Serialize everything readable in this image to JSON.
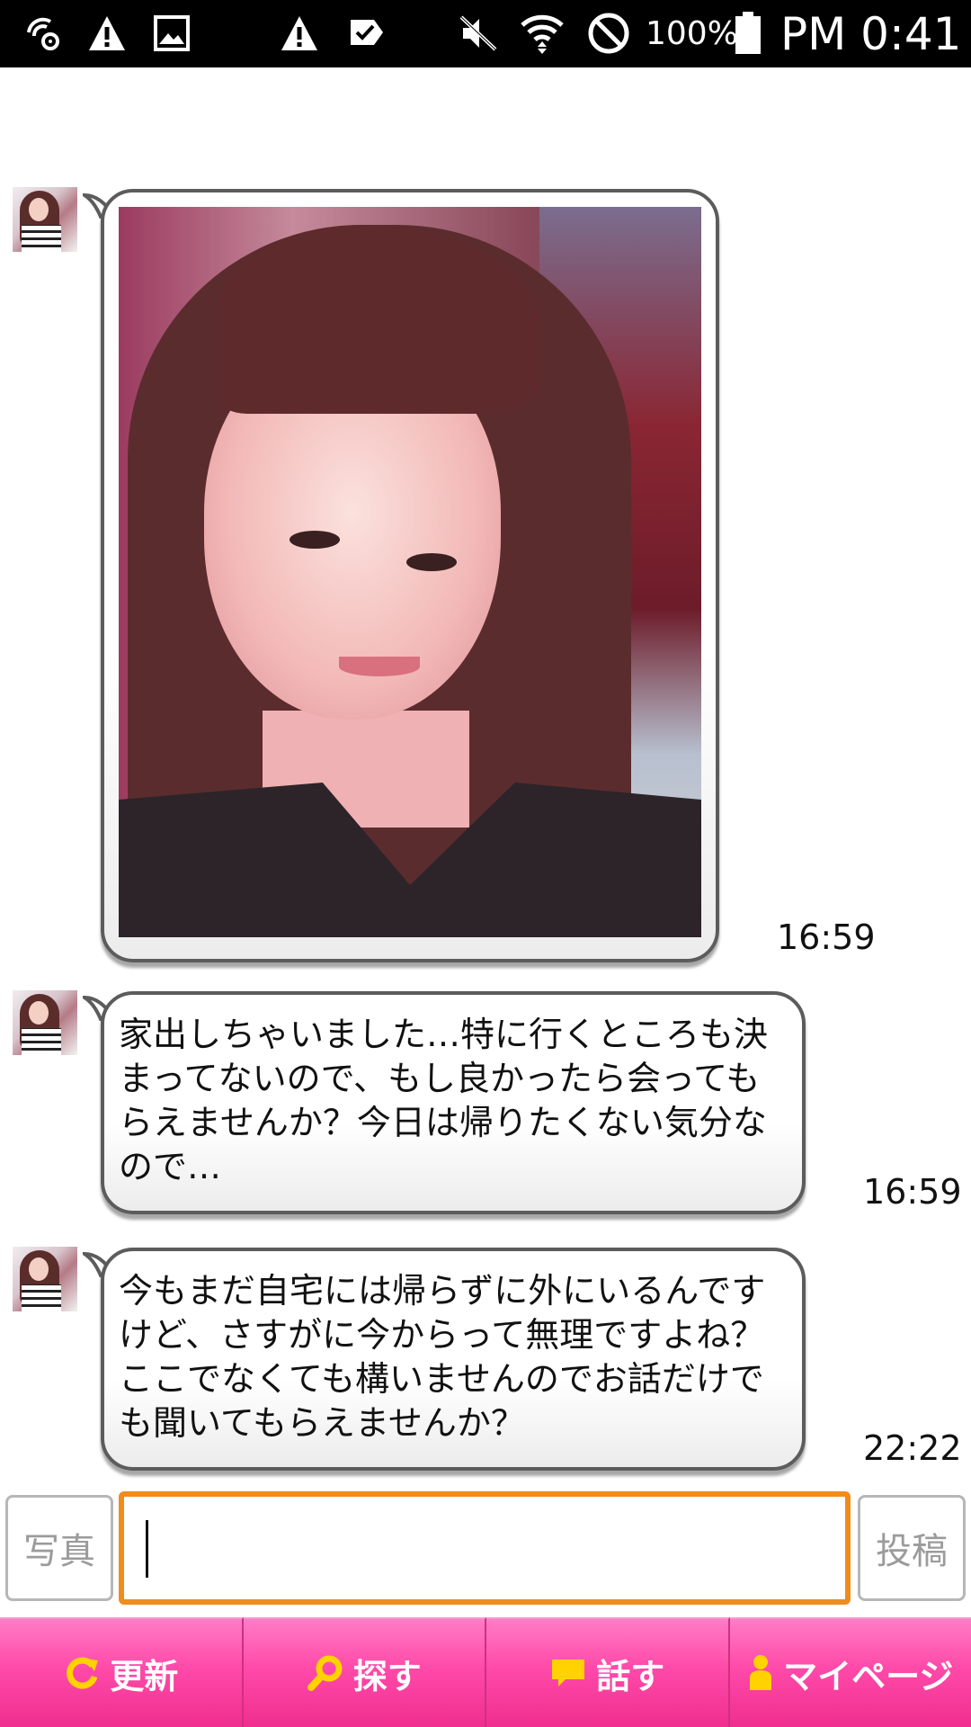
{
  "status_bar": {
    "battery_percent": "100%",
    "clock": "PM 0:41",
    "icons": [
      "wifi-settings-icon",
      "warning-icon",
      "image-icon",
      "warning-icon",
      "checkmark-flag-icon",
      "mute-icon",
      "wifi-icon",
      "blocked-icon",
      "battery-icon"
    ]
  },
  "chat": {
    "messages": [
      {
        "type": "photo",
        "avatar": "sender-avatar",
        "time": "16:59"
      },
      {
        "type": "text",
        "avatar": "sender-avatar",
        "text": "家出しちゃいました…特に行くところも決まってないので、もし良かったら会ってもらえませんか？今日は帰りたくない気分なので…",
        "time": "16:59"
      },
      {
        "type": "text",
        "avatar": "sender-avatar",
        "text": "今もまだ自宅には帰らずに外にいるんですけど、さすがに今からって無理ですよね？ここでなくても構いませんのでお話だけでも聞いてもらえませんか？",
        "time": "22:22"
      }
    ]
  },
  "composer": {
    "photo_button": "写真",
    "input_value": "",
    "post_button": "投稿"
  },
  "bottom_nav": {
    "items": [
      {
        "label": "更新",
        "icon": "refresh-icon"
      },
      {
        "label": "探す",
        "icon": "search-icon"
      },
      {
        "label": "話す",
        "icon": "chat-bubble-icon"
      },
      {
        "label": "マイページ",
        "icon": "person-icon"
      }
    ]
  },
  "colors": {
    "status_bar_bg": "#000000",
    "input_border": "#f08c1c",
    "nav_pink": "#ff4aa9",
    "nav_icon_yellow": "#ffd200",
    "bubble_border": "#5c5c5c"
  }
}
